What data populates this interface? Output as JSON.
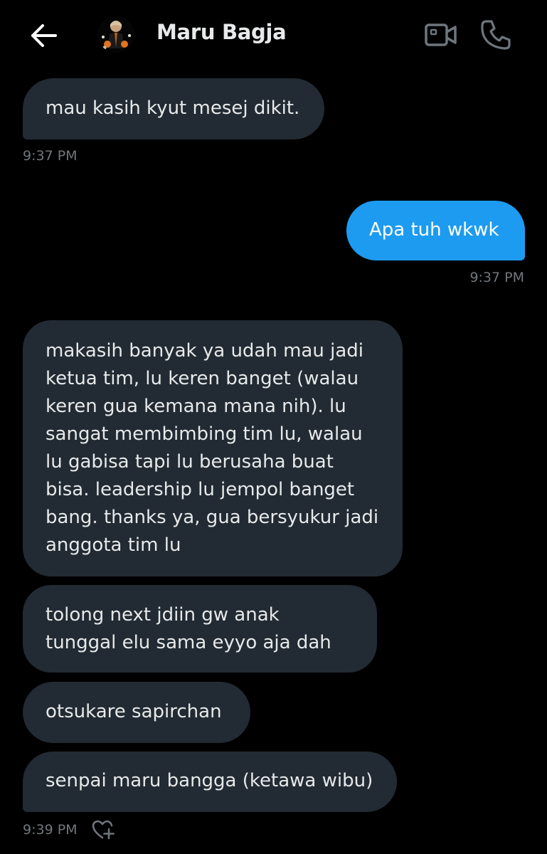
{
  "header": {
    "contact_name": "Maru Bagja",
    "back_icon": "arrow-left-icon",
    "video_icon": "video-camera-icon",
    "call_icon": "phone-icon"
  },
  "messages": [
    {
      "direction": "incoming",
      "text": "mau kasih kyut mesej dikit."
    },
    {
      "direction": "outgoing",
      "text": "Apa tuh wkwk"
    },
    {
      "direction": "incoming",
      "text": "makasih banyak ya udah mau jadi ketua tim, lu keren banget (walau keren gua kemana mana nih). lu sangat membimbing tim lu, walau lu gabisa tapi lu berusaha buat bisa. leadership lu jempol banget bang. thanks ya, gua bersyukur jadi anggota tim lu"
    },
    {
      "direction": "incoming",
      "text": "tolong next jdiin gw anak tunggal elu sama eyyo aja dah"
    },
    {
      "direction": "incoming",
      "text": "otsukare sapirchan"
    },
    {
      "direction": "incoming",
      "text": "senpai maru bangga (ketawa wibu)"
    }
  ],
  "timestamps": [
    "9:37 PM",
    "9:37 PM",
    "9:39 PM"
  ],
  "reaction_icon": "add-reaction-heart-icon",
  "colors": {
    "background": "#000000",
    "incoming_bubble": "#222b33",
    "outgoing_bubble": "#1d9bf0",
    "text": "#e7e9ea",
    "timestamp": "#71767b"
  }
}
